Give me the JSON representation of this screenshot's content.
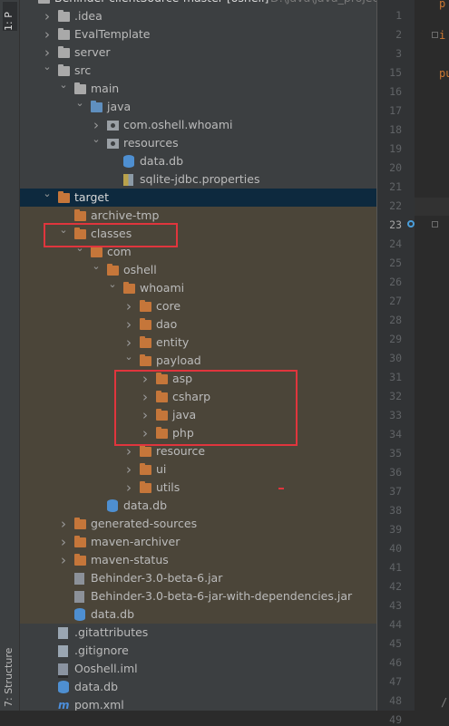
{
  "side_tabs": {
    "project": "1: P",
    "structure": "7: Structure"
  },
  "tree": {
    "root_partial": "Behinder-clientSource-master [oshell]",
    "root_path_partial": "D:\\java\\java_project",
    "items": [
      {
        "label": ".idea",
        "icon": "folder-icon",
        "expanded": false
      },
      {
        "label": "EvalTemplate",
        "icon": "folder-icon",
        "expanded": false
      },
      {
        "label": "server",
        "icon": "folder-icon",
        "expanded": false
      },
      {
        "label": "src",
        "icon": "folder-icon",
        "expanded": true
      },
      {
        "label": "main",
        "icon": "folder-icon",
        "expanded": true
      },
      {
        "label": "java",
        "icon": "source-folder-icon",
        "expanded": true
      },
      {
        "label": "com.oshell.whoami",
        "icon": "package-icon",
        "expanded": false
      },
      {
        "label": "resources",
        "icon": "resources-folder-icon",
        "expanded": true
      },
      {
        "label": "data.db",
        "icon": "database-icon"
      },
      {
        "label": "sqlite-jdbc.properties",
        "icon": "properties-file-icon"
      },
      {
        "label": "target",
        "icon": "folder-icon",
        "expanded": true,
        "selected": true
      },
      {
        "label": "archive-tmp",
        "icon": "folder-icon"
      },
      {
        "label": "classes",
        "icon": "folder-icon",
        "expanded": true
      },
      {
        "label": "com",
        "icon": "folder-icon",
        "expanded": true
      },
      {
        "label": "oshell",
        "icon": "folder-icon",
        "expanded": true
      },
      {
        "label": "whoami",
        "icon": "folder-icon",
        "expanded": true
      },
      {
        "label": "core",
        "icon": "folder-icon",
        "expanded": false
      },
      {
        "label": "dao",
        "icon": "folder-icon",
        "expanded": false
      },
      {
        "label": "entity",
        "icon": "folder-icon",
        "expanded": false
      },
      {
        "label": "payload",
        "icon": "folder-icon",
        "expanded": true
      },
      {
        "label": "asp",
        "icon": "folder-icon",
        "expanded": false
      },
      {
        "label": "csharp",
        "icon": "folder-icon",
        "expanded": false
      },
      {
        "label": "java",
        "icon": "folder-icon",
        "expanded": false
      },
      {
        "label": "php",
        "icon": "folder-icon",
        "expanded": false
      },
      {
        "label": "resource",
        "icon": "folder-icon",
        "expanded": false
      },
      {
        "label": "ui",
        "icon": "folder-icon",
        "expanded": false
      },
      {
        "label": "utils",
        "icon": "folder-icon",
        "expanded": false
      },
      {
        "label": "data.db",
        "icon": "database-icon"
      },
      {
        "label": "generated-sources",
        "icon": "folder-icon",
        "expanded": false
      },
      {
        "label": "maven-archiver",
        "icon": "folder-icon",
        "expanded": false
      },
      {
        "label": "maven-status",
        "icon": "folder-icon",
        "expanded": false
      },
      {
        "label": "Behinder-3.0-beta-6.jar",
        "icon": "jar-file-icon"
      },
      {
        "label": "Behinder-3.0-beta-6-jar-with-dependencies.jar",
        "icon": "jar-file-icon"
      },
      {
        "label": "data.db",
        "icon": "database-icon"
      },
      {
        "label": ".gitattributes",
        "icon": "git-file-icon"
      },
      {
        "label": ".gitignore",
        "icon": "git-file-icon"
      },
      {
        "label": "Ooshell.iml",
        "icon": "iml-file-icon"
      },
      {
        "label": "data.db",
        "icon": "database-icon"
      },
      {
        "label": "pom.xml",
        "icon": "maven-pom-icon"
      }
    ]
  },
  "editor": {
    "line_numbers": [
      "1",
      "2",
      "3",
      "15",
      "16",
      "17",
      "18",
      "19",
      "20",
      "21",
      "22",
      "23",
      "24",
      "25",
      "26",
      "27",
      "28",
      "29",
      "30",
      "31",
      "32",
      "33",
      "34",
      "35",
      "36",
      "37",
      "38",
      "39",
      "40",
      "41",
      "42",
      "43",
      "44",
      "45",
      "46",
      "47",
      "48",
      "49"
    ],
    "current_line": "23",
    "code_fragments": [
      "p",
      "i",
      "pu",
      "/"
    ]
  },
  "colors": {
    "selection": "#0d293e",
    "excluded_bg": "#4b4539",
    "highlight_box": "#e0353d",
    "folder_orange": "#c5763a"
  }
}
